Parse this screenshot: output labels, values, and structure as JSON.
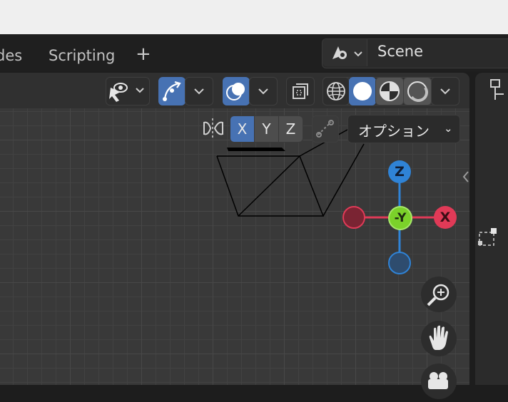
{
  "tabs": [
    {
      "label": "des"
    },
    {
      "label": "Scripting"
    }
  ],
  "add_workspace": "+",
  "scene": {
    "name": "Scene"
  },
  "axes_toggle": {
    "x": "X",
    "y": "Y",
    "z": "Z"
  },
  "options_dropdown": {
    "label": "オプション"
  },
  "gizmo": {
    "z": "Z",
    "neg_y": "-Y",
    "x": "X"
  },
  "colors": {
    "accent": "#4772b3",
    "x_axis": "#e03a57",
    "y_axis": "#7bd12a",
    "z_axis": "#2f83d6"
  }
}
